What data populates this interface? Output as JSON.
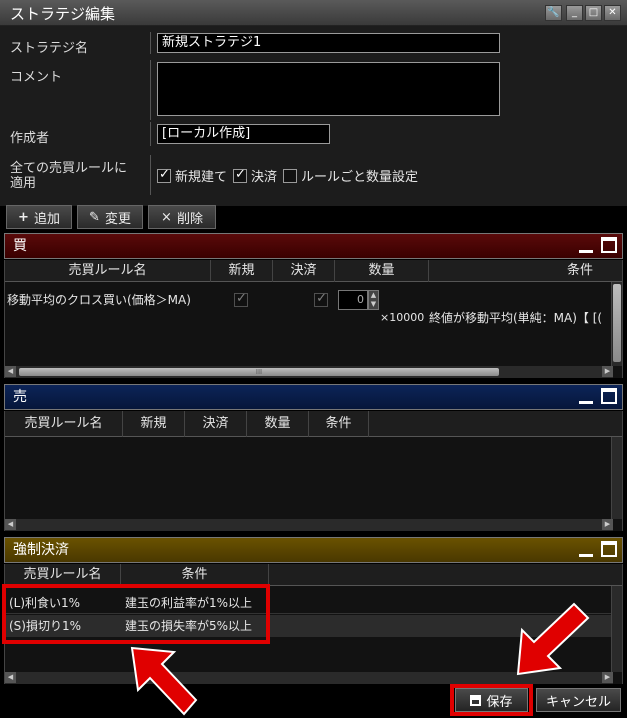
{
  "window": {
    "title": "ストラテジ編集"
  },
  "form": {
    "strategy_name_label": "ストラテジ名",
    "strategy_name_value": "新規ストラテジ1",
    "comment_label": "コメント",
    "comment_value": "",
    "creator_label": "作成者",
    "creator_value": "[ローカル作成]",
    "apply_all_label_line1": "全ての売買ルールに",
    "apply_all_label_line2": "適用",
    "checkboxes": [
      {
        "label": "新規建て",
        "checked": true
      },
      {
        "label": "決済",
        "checked": true
      },
      {
        "label": "ルールごと数量設定",
        "checked": false
      }
    ]
  },
  "toolbar": {
    "add_label": "追加",
    "edit_label": "変更",
    "delete_label": "削除"
  },
  "buy_section": {
    "title": "買",
    "columns": [
      "売買ルール名",
      "新規",
      "決済",
      "数量",
      "条件"
    ],
    "rows": [
      {
        "rule_name": "移動平均のクロス買い(価格＞MA)",
        "new": true,
        "settle": true,
        "quantity": "0",
        "multiplier": "×10000",
        "condition": "終値が移動平均(単純：MA)【 [("
      }
    ],
    "scroll_grip": "III"
  },
  "sell_section": {
    "title": "売",
    "columns": [
      "売買ルール名",
      "新規",
      "決済",
      "数量",
      "条件"
    ],
    "rows": []
  },
  "force_section": {
    "title": "強制決済",
    "columns": [
      "売買ルール名",
      "条件"
    ],
    "rows": [
      {
        "rule_name": "(L)利食い1%",
        "condition": "建玉の利益率が1%以上"
      },
      {
        "rule_name": "(S)損切り1%",
        "condition": "建玉の損失率が5%以上"
      }
    ]
  },
  "footer": {
    "save_label": "保存",
    "cancel_label": "キャンセル"
  },
  "colors": {
    "buy_header": "#4a0505",
    "sell_header": "#0a1e4a",
    "force_header": "#5a4500",
    "highlight": "#e00000"
  }
}
